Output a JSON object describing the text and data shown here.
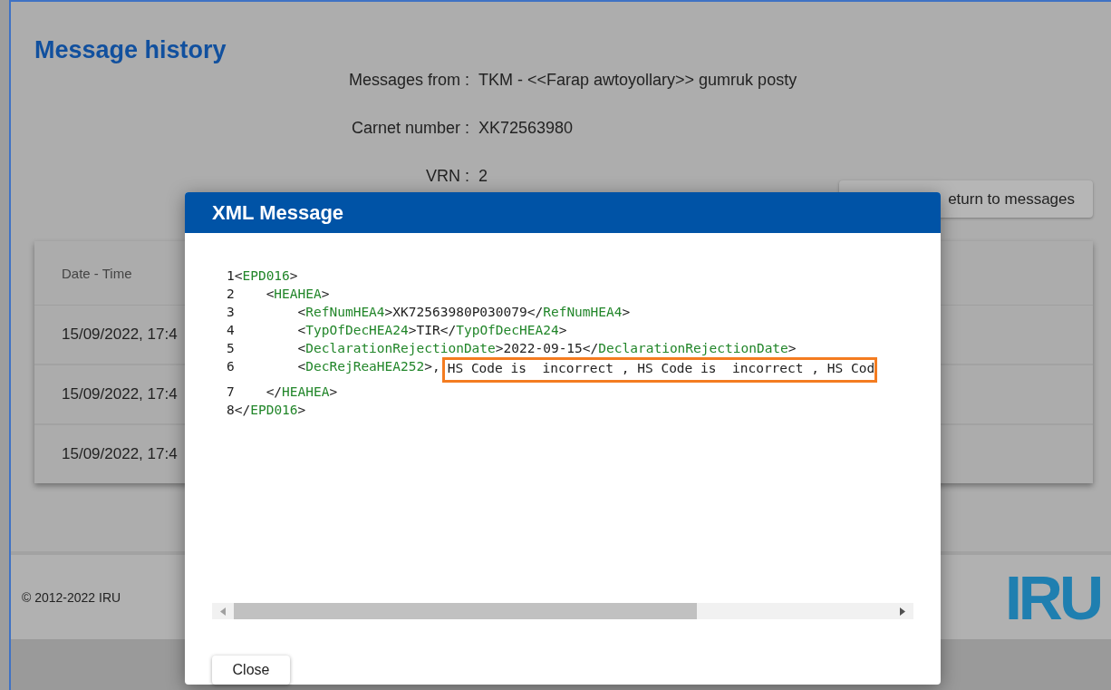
{
  "page": {
    "title": "Message history",
    "info": [
      {
        "label": "Messages from :",
        "value": "TKM - <<Farap awtoyollary>> gumruk posty"
      },
      {
        "label": "Carnet number :",
        "value": "XK72563980"
      },
      {
        "label": "VRN :",
        "value": "2"
      }
    ],
    "return_button": "eturn to messages",
    "table": {
      "columns": [
        "Date - Time"
      ],
      "rows": [
        [
          "15/09/2022, 17:4"
        ],
        [
          "15/09/2022, 17:4"
        ],
        [
          "15/09/2022, 17:4"
        ]
      ]
    },
    "footer": {
      "copyright": "© 2012-2022 IRU",
      "logo": "IRU"
    }
  },
  "dialog": {
    "title": "XML Message",
    "lines": [
      {
        "number": "1",
        "parts": [
          {
            "kind": "punct",
            "text": "<"
          },
          {
            "kind": "tag",
            "text": "EPD016"
          },
          {
            "kind": "punct",
            "text": ">"
          }
        ],
        "children": [
          {
            "number": "2",
            "parts": [
              {
                "kind": "punct",
                "text": "<"
              },
              {
                "kind": "tag",
                "text": "HEAHEA"
              },
              {
                "kind": "punct",
                "text": ">"
              }
            ],
            "children": [
              {
                "number": "3",
                "parts": [
                  {
                    "kind": "punct",
                    "text": "<"
                  },
                  {
                    "kind": "tag",
                    "text": "RefNumHEA4"
                  },
                  {
                    "kind": "punct",
                    "text": ">"
                  },
                  {
                    "kind": "text",
                    "text": "XK72563980P030079"
                  },
                  {
                    "kind": "punct",
                    "text": "</"
                  },
                  {
                    "kind": "tag",
                    "text": "RefNumHEA4"
                  },
                  {
                    "kind": "punct",
                    "text": ">"
                  }
                ]
              },
              {
                "number": "4",
                "parts": [
                  {
                    "kind": "punct",
                    "text": "<"
                  },
                  {
                    "kind": "tag",
                    "text": "TypOfDecHEA24"
                  },
                  {
                    "kind": "punct",
                    "text": ">"
                  },
                  {
                    "kind": "text",
                    "text": "TIR"
                  },
                  {
                    "kind": "punct",
                    "text": "</"
                  },
                  {
                    "kind": "tag",
                    "text": "TypOfDecHEA24"
                  },
                  {
                    "kind": "punct",
                    "text": ">"
                  }
                ]
              },
              {
                "number": "5",
                "parts": [
                  {
                    "kind": "punct",
                    "text": "<"
                  },
                  {
                    "kind": "tag",
                    "text": "DeclarationRejectionDate"
                  },
                  {
                    "kind": "punct",
                    "text": ">"
                  },
                  {
                    "kind": "text",
                    "text": "2022-09-15"
                  },
                  {
                    "kind": "punct",
                    "text": "</"
                  },
                  {
                    "kind": "tag",
                    "text": "DeclarationRejectionDate"
                  },
                  {
                    "kind": "punct",
                    "text": ">"
                  }
                ]
              },
              {
                "number": "6",
                "parts": [
                  {
                    "kind": "punct",
                    "text": "<"
                  },
                  {
                    "kind": "tag",
                    "text": "DecRejReaHEA252"
                  },
                  {
                    "kind": "punct",
                    "text": ">"
                  },
                  {
                    "kind": "text",
                    "text": ","
                  },
                  {
                    "kind": "highlight",
                    "text": "HS Code is  incorrect , HS Code is  incorrect , HS Cod"
                  }
                ]
              }
            ]
          },
          {
            "number": "7",
            "parts": [
              {
                "kind": "punct",
                "text": "</"
              },
              {
                "kind": "tag",
                "text": "HEAHEA"
              },
              {
                "kind": "punct",
                "text": ">"
              }
            ]
          }
        ]
      },
      {
        "number": "8",
        "parts": [
          {
            "kind": "punct",
            "text": "</"
          },
          {
            "kind": "tag",
            "text": "EPD016"
          },
          {
            "kind": "punct",
            "text": ">"
          }
        ]
      }
    ],
    "close_button": "Close"
  }
}
